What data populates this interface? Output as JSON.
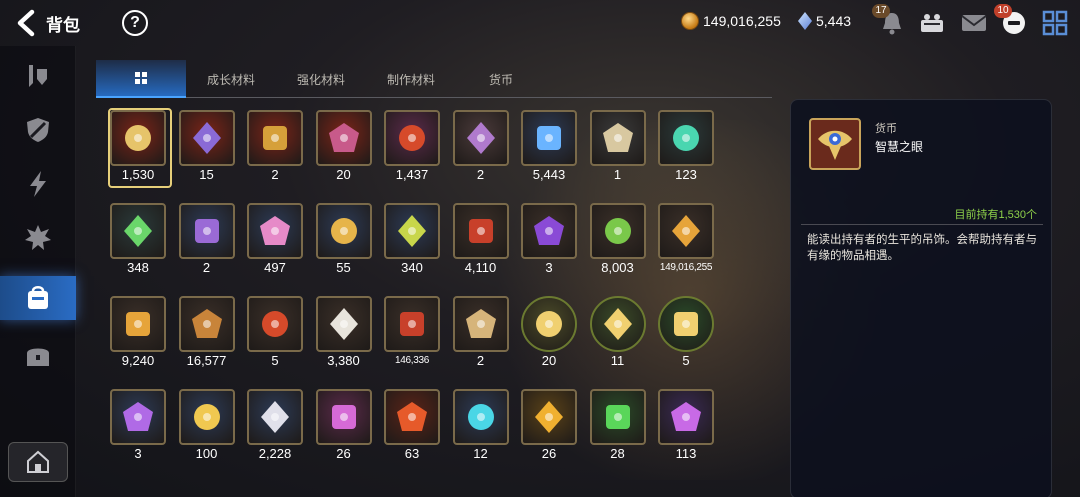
{
  "header": {
    "title": "背包",
    "help_label": "?",
    "gold_amount": "149,016,255",
    "crystal_amount": "5,443",
    "bell_badge": "17",
    "chat_badge": "10"
  },
  "tabs": [
    {
      "label": "",
      "icon": "grid-icon",
      "active": true
    },
    {
      "label": "成长材料",
      "active": false
    },
    {
      "label": "强化材料",
      "active": false
    },
    {
      "label": "制作材料",
      "active": false
    },
    {
      "label": "货币",
      "active": false
    }
  ],
  "sidebar": {
    "items": [
      {
        "icon": "equipment-icon"
      },
      {
        "icon": "shield-icon"
      },
      {
        "icon": "lightning-icon"
      },
      {
        "icon": "spiky-icon"
      },
      {
        "icon": "bag-icon",
        "active": true
      },
      {
        "icon": "chest-icon"
      }
    ],
    "bottom_icon": "house-icon"
  },
  "items": [
    {
      "name": "eye-of-wisdom",
      "qty": "1,530",
      "selected": true,
      "color": "#7a2418"
    },
    {
      "name": "eye-badge",
      "qty": "15",
      "color": "#7a2418"
    },
    {
      "name": "amber-crystal",
      "qty": "2",
      "color": "#7a2418"
    },
    {
      "name": "purple-medal",
      "qty": "20",
      "color": "#7a2418"
    },
    {
      "name": "red-orb",
      "qty": "1,437",
      "color": "#5a2a4a"
    },
    {
      "name": "purple-card",
      "qty": "2",
      "color": "#4a3a3a"
    },
    {
      "name": "blue-crystal",
      "qty": "5,443",
      "color": "#2c3a55"
    },
    {
      "name": "book",
      "qty": "1",
      "color": "#3a3a3a"
    },
    {
      "name": "green-gem",
      "qty": "123",
      "color": "#2a3a3a"
    },
    {
      "name": "green-leaf",
      "qty": "348",
      "color": "#2a3a3a"
    },
    {
      "name": "purple-tarot",
      "qty": "2",
      "color": "#2c3a55"
    },
    {
      "name": "pink-crystal",
      "qty": "497",
      "color": "#2c3a55"
    },
    {
      "name": "star-compass",
      "qty": "55",
      "color": "#2c3a55"
    },
    {
      "name": "green-card",
      "qty": "340",
      "color": "#2c3a55"
    },
    {
      "name": "red-bracelet",
      "qty": "4,110",
      "color": "#3a2f28"
    },
    {
      "name": "purple-seal",
      "qty": "3",
      "color": "#3a2f28"
    },
    {
      "name": "green-heart",
      "qty": "8,003",
      "color": "#3a2f28"
    },
    {
      "name": "gold-coin",
      "qty": "149,016,255",
      "small": true,
      "color": "#3a2f28"
    },
    {
      "name": "gold-hexagon",
      "qty": "9,240",
      "color": "#3a2f28"
    },
    {
      "name": "bronze-badge",
      "qty": "16,577",
      "color": "#3a2f28"
    },
    {
      "name": "red-flag",
      "qty": "5",
      "color": "#3a2f28"
    },
    {
      "name": "white-chess",
      "qty": "3,380",
      "color": "#3a2f28"
    },
    {
      "name": "red-crest",
      "qty": "146,336",
      "small": true,
      "color": "#3a2f28"
    },
    {
      "name": "ticket",
      "qty": "2",
      "color": "#3a2f28"
    },
    {
      "name": "cat-token-a",
      "qty": "20",
      "round": true,
      "color": "#4a4a28"
    },
    {
      "name": "cat-token-b",
      "qty": "11",
      "round": true,
      "color": "#3a4a28"
    },
    {
      "name": "cat-token-c",
      "qty": "5",
      "round": true,
      "color": "#2a4a28"
    },
    {
      "name": "purple-lotus",
      "qty": "3",
      "color": "#2c3a55"
    },
    {
      "name": "gold-lotus",
      "qty": "100",
      "color": "#2c3a55"
    },
    {
      "name": "white-lotus",
      "qty": "2,228",
      "color": "#2c3a55"
    },
    {
      "name": "pink-rune",
      "qty": "26",
      "color": "#5a2a4a"
    },
    {
      "name": "red-rune",
      "qty": "63",
      "color": "#5a2418"
    },
    {
      "name": "blue-rune",
      "qty": "12",
      "color": "#2c3a55"
    },
    {
      "name": "yellow-rune",
      "qty": "26",
      "color": "#5a4218"
    },
    {
      "name": "green-rune",
      "qty": "28",
      "color": "#2a4a28"
    },
    {
      "name": "purple-rune",
      "qty": "113",
      "color": "#3a2a55"
    }
  ],
  "detail": {
    "category": "货币",
    "name": "智慧之眼",
    "holding": "目前持有1,530个",
    "description": "能读出持有者的生平的吊饰。会帮助持有者与有缘的物品相遇。"
  }
}
